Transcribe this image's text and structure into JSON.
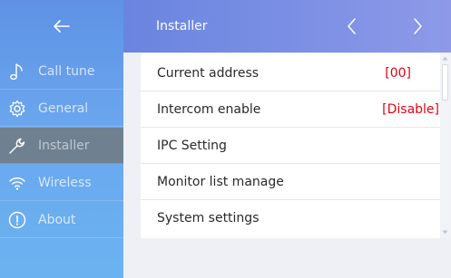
{
  "header": {
    "title": "Installer",
    "colors": {
      "header_start": "#6a85e0",
      "header_end": "#8e99e8"
    }
  },
  "sidebar": {
    "colors": {
      "top": "#5f92e5",
      "bottom": "#6bb3f0",
      "active": "#6f8190"
    },
    "items": [
      {
        "label": "Call tune",
        "icon": "music-note-icon",
        "active": false
      },
      {
        "label": "General",
        "icon": "gear-icon",
        "active": false
      },
      {
        "label": "Installer",
        "icon": "wrench-icon",
        "active": true
      },
      {
        "label": "Wireless",
        "icon": "wifi-icon",
        "active": false
      },
      {
        "label": "About",
        "icon": "info-icon",
        "active": false
      }
    ]
  },
  "settings": {
    "value_color": "#e8000f",
    "rows": [
      {
        "label": "Current address",
        "value": "[00]"
      },
      {
        "label": "Intercom enable",
        "value": "[Disable]"
      },
      {
        "label": "IPC Setting",
        "value": ""
      },
      {
        "label": "Monitor list manage",
        "value": ""
      },
      {
        "label": "System settings",
        "value": ""
      }
    ]
  }
}
